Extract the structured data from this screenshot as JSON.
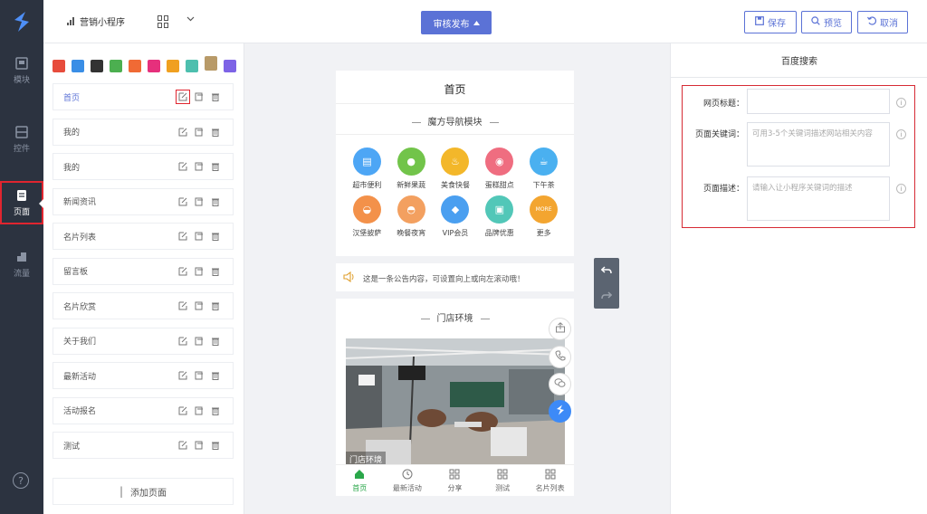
{
  "topbar": {
    "app_name": "营销小程序",
    "publish_label": "审核发布",
    "save_label": "保存",
    "preview_label": "预览",
    "cancel_label": "取消"
  },
  "rail": {
    "items": [
      {
        "label": "模块",
        "icon": "module-icon"
      },
      {
        "label": "控件",
        "icon": "widget-icon"
      },
      {
        "label": "页面",
        "icon": "page-icon",
        "active": true
      },
      {
        "label": "流量",
        "icon": "traffic-icon"
      }
    ],
    "help": "?"
  },
  "theme_colors": [
    "#e74c3c",
    "#3a8ee6",
    "#333333",
    "#4caf50",
    "#f06a35",
    "#e6307c",
    "#f0a020",
    "#4dbfae",
    "#b89a68",
    "#7d63e6"
  ],
  "pages": {
    "items": [
      {
        "label": "首页",
        "active": true
      },
      {
        "label": "我的"
      },
      {
        "label": "我的"
      },
      {
        "label": "新闻资讯"
      },
      {
        "label": "名片列表"
      },
      {
        "label": "留言板"
      },
      {
        "label": "名片欣赏"
      },
      {
        "label": "关于我们"
      },
      {
        "label": "最新活动"
      },
      {
        "label": "活动报名"
      },
      {
        "label": "测试"
      }
    ],
    "add_label": "添加页面"
  },
  "phone": {
    "title": "首页",
    "nav_section_title": "魔方导航模块",
    "nav_items": [
      {
        "label": "超市便利",
        "color": "#4da6f5",
        "glyph": "▤"
      },
      {
        "label": "新鲜果蔬",
        "color": "#72c44a",
        "glyph": "●"
      },
      {
        "label": "美食快餐",
        "color": "#f3b72a",
        "glyph": "♨"
      },
      {
        "label": "蛋糕甜点",
        "color": "#ef6d80",
        "glyph": "◉"
      },
      {
        "label": "下午茶",
        "color": "#4ab0f0",
        "glyph": "☕"
      },
      {
        "label": "汉堡披萨",
        "color": "#f3914a",
        "glyph": "◒"
      },
      {
        "label": "晚餐夜宵",
        "color": "#f3a060",
        "glyph": "◓"
      },
      {
        "label": "VIP会员",
        "color": "#4a9ff0",
        "glyph": "◆"
      },
      {
        "label": "品牌优惠",
        "color": "#52c7b8",
        "glyph": "▣"
      },
      {
        "label": "更多",
        "color": "#f3a530",
        "glyph": "MORE"
      }
    ],
    "notice": "这是一条公告内容，可设置向上或向左滚动哦！",
    "store_section_title": "门店环境",
    "store_caption": "门店环境",
    "tabs": [
      {
        "label": "首页",
        "icon": "home-icon",
        "active": true
      },
      {
        "label": "最新活动",
        "icon": "clock-icon"
      },
      {
        "label": "分享",
        "icon": "grid-icon"
      },
      {
        "label": "测试",
        "icon": "grid-icon"
      },
      {
        "label": "名片列表",
        "icon": "grid-icon"
      }
    ]
  },
  "seo": {
    "panel_title": "百度搜索",
    "fields": [
      {
        "label": "网页标题：",
        "value": "",
        "placeholder": ""
      },
      {
        "label": "页面关键词：",
        "value": "",
        "placeholder": "可用3-5个关键词描述网站相关内容"
      },
      {
        "label": "页面描述：",
        "value": "",
        "placeholder": "请输入让小程序关键词的描述"
      }
    ]
  }
}
